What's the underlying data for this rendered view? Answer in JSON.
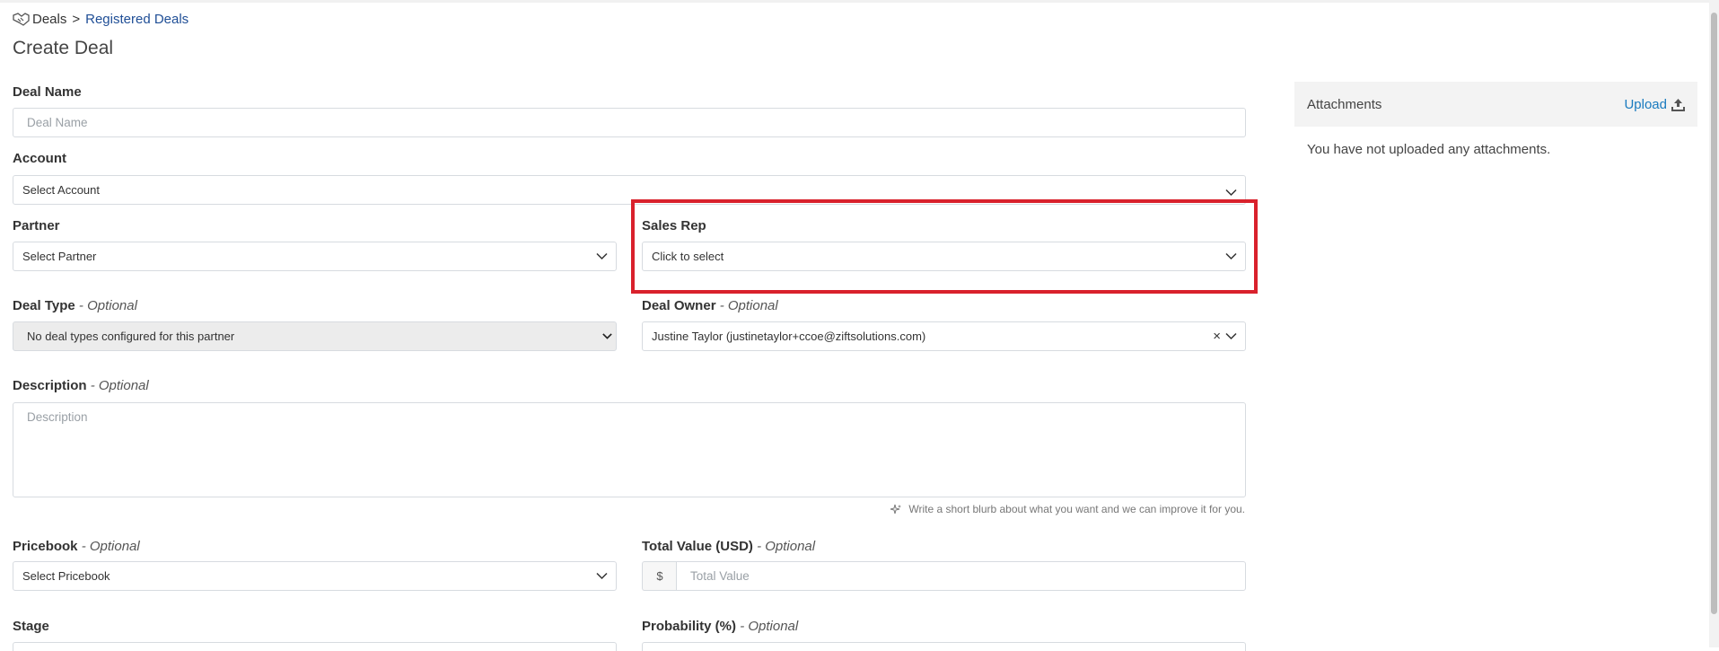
{
  "breadcrumb": {
    "root": "Deals",
    "separator": ">",
    "current": "Registered Deals"
  },
  "page": {
    "title": "Create Deal"
  },
  "form": {
    "optional_suffix": "- Optional",
    "deal_name": {
      "label": "Deal Name",
      "placeholder": "Deal Name"
    },
    "account": {
      "label": "Account",
      "value": "Select Account"
    },
    "partner": {
      "label": "Partner",
      "value": "Select Partner"
    },
    "sales_rep": {
      "label": "Sales Rep",
      "value": "Click to select"
    },
    "deal_type": {
      "label": "Deal Type",
      "value": "No deal types configured for this partner"
    },
    "deal_owner": {
      "label": "Deal Owner",
      "value": "Justine Taylor (justinetaylor+ccoe@ziftsolutions.com)",
      "clear": "×"
    },
    "description": {
      "label": "Description",
      "placeholder": "Description",
      "hint": "Write a short blurb about what you want and we can improve it for you."
    },
    "pricebook": {
      "label": "Pricebook",
      "value": "Select Pricebook"
    },
    "total_value": {
      "label": "Total Value (USD)",
      "prefix": "$",
      "placeholder": "Total Value"
    },
    "stage": {
      "label": "Stage"
    },
    "probability": {
      "label": "Probability (%)"
    }
  },
  "attachments": {
    "title": "Attachments",
    "upload_label": "Upload",
    "empty_text": "You have not uploaded any attachments."
  },
  "colors": {
    "link": "#1f4e96",
    "upload": "#1a7bbf",
    "highlight": "#d9212c"
  }
}
